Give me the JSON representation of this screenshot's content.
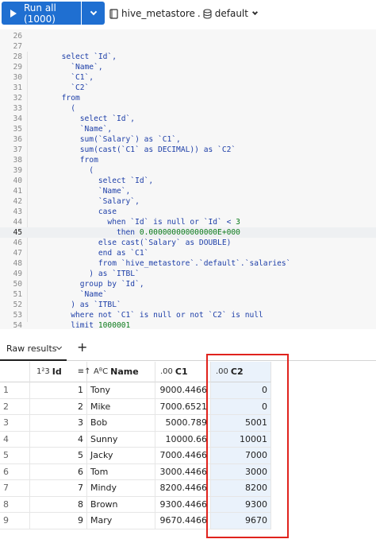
{
  "toolbar": {
    "run_all_label": "Run all  (1000)",
    "catalog": "hive_metastore",
    "schema": "default"
  },
  "editor": {
    "active_line": "45",
    "lines": [
      {
        "n": "26",
        "t": ""
      },
      {
        "n": "27",
        "t": ""
      },
      {
        "n": "28",
        "t": "      select `Id`,"
      },
      {
        "n": "29",
        "t": "        `Name`,"
      },
      {
        "n": "30",
        "t": "        `C1`,"
      },
      {
        "n": "31",
        "t": "        `C2`"
      },
      {
        "n": "32",
        "t": "      from"
      },
      {
        "n": "33",
        "t": "        ("
      },
      {
        "n": "34",
        "t": "          select `Id`,"
      },
      {
        "n": "35",
        "t": "          `Name`,"
      },
      {
        "n": "36",
        "t": "          sum(`Salary`) as `C1`,"
      },
      {
        "n": "37",
        "t": "          sum(cast(`C1` as DECIMAL)) as `C2`"
      },
      {
        "n": "38",
        "t": "          from"
      },
      {
        "n": "39",
        "t": "            ("
      },
      {
        "n": "40",
        "t": "              select `Id`,"
      },
      {
        "n": "41",
        "t": "              `Name`,"
      },
      {
        "n": "42",
        "t": "              `Salary`,"
      },
      {
        "n": "43",
        "t": "              case"
      },
      {
        "n": "44",
        "t": "                when `Id` is null or `Id` < 3"
      },
      {
        "n": "45",
        "t": "                  then 0.000000000000000E+000"
      },
      {
        "n": "46",
        "t": "              else cast(`Salary` as DOUBLE)"
      },
      {
        "n": "47",
        "t": "              end as `C1`"
      },
      {
        "n": "48",
        "t": "              from `hive_metastore`.`default`.`salaries`"
      },
      {
        "n": "49",
        "t": "            ) as `ITBL`"
      },
      {
        "n": "50",
        "t": "          group by `Id`,"
      },
      {
        "n": "51",
        "t": "          `Name`"
      },
      {
        "n": "52",
        "t": "        ) as `ITBL`"
      },
      {
        "n": "53",
        "t": "        where not `C1` is null or not `C2` is null"
      },
      {
        "n": "54",
        "t": "        limit 1000001"
      }
    ]
  },
  "results": {
    "tab_label": "Raw results",
    "add_label": "+",
    "columns": [
      {
        "type": "1²3",
        "label": "Id"
      },
      {
        "type": "AᴮC",
        "label": "Name"
      },
      {
        "type": ".00",
        "label": "C1"
      },
      {
        "type": ".00",
        "label": "C2"
      }
    ],
    "rows": [
      {
        "i": "1",
        "id": "1",
        "name": "Tony",
        "c1": "9000.4466",
        "c2": "0"
      },
      {
        "i": "2",
        "id": "2",
        "name": "Mike",
        "c1": "7000.6521",
        "c2": "0"
      },
      {
        "i": "3",
        "id": "3",
        "name": "Bob",
        "c1": "5000.789",
        "c2": "5001"
      },
      {
        "i": "4",
        "id": "4",
        "name": "Sunny",
        "c1": "10000.66",
        "c2": "10001"
      },
      {
        "i": "5",
        "id": "5",
        "name": "Jacky",
        "c1": "7000.4466",
        "c2": "7000"
      },
      {
        "i": "6",
        "id": "6",
        "name": "Tom",
        "c1": "3000.4466",
        "c2": "3000"
      },
      {
        "i": "7",
        "id": "7",
        "name": "Mindy",
        "c1": "8200.4466",
        "c2": "8200"
      },
      {
        "i": "8",
        "id": "8",
        "name": "Brown",
        "c1": "9300.4466",
        "c2": "9300"
      },
      {
        "i": "9",
        "id": "9",
        "name": "Mary",
        "c1": "9670.4466",
        "c2": "9670"
      }
    ]
  },
  "colors": {
    "accent": "#1f6fd1",
    "highlight_box": "#e0231d",
    "selected_column": "#eaf2fb"
  }
}
